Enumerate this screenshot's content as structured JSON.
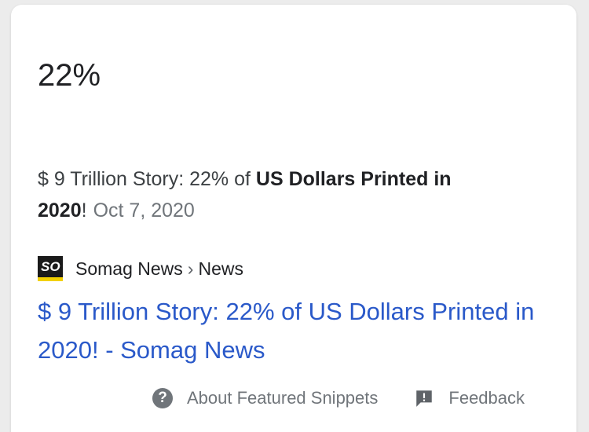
{
  "answer": "22%",
  "snippet": {
    "prefix": "$ 9 Trillion Story: 22% of ",
    "bold_1": "US Dollars Printed in",
    "bold_2": "2020",
    "suffix": "!",
    "date": "Oct 7, 2020"
  },
  "source": {
    "favicon_text": "SO",
    "site": "Somag News",
    "separator": "›",
    "section": "News"
  },
  "result_title": "$ 9 Trillion Story: 22% of US Dollars Printed in 2020! - Somag News",
  "footer": {
    "about_label": "About Featured Snippets",
    "feedback_label": "Feedback"
  }
}
